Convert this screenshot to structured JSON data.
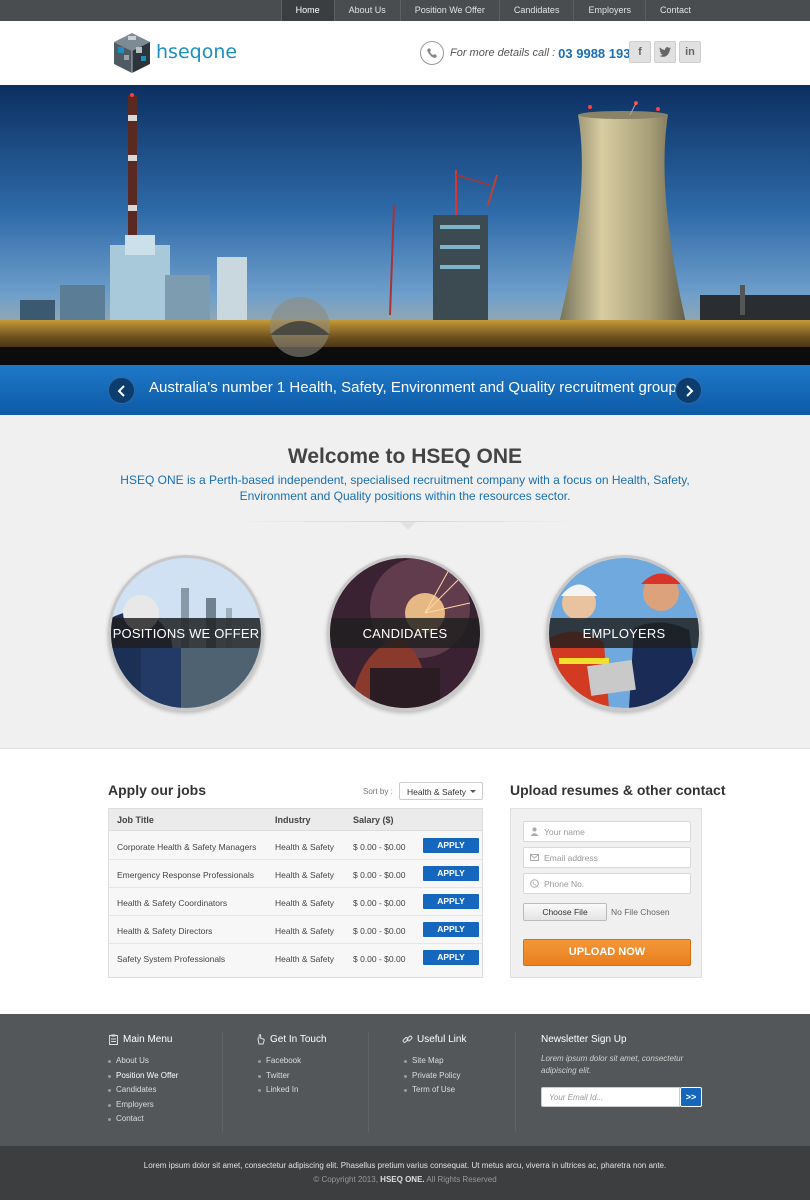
{
  "nav": {
    "items": [
      {
        "label": "Home",
        "active": true
      },
      {
        "label": "About Us"
      },
      {
        "label": "Position We Offer"
      },
      {
        "label": "Candidates"
      },
      {
        "label": "Employers"
      },
      {
        "label": "Contact"
      }
    ]
  },
  "header": {
    "logo_text": "hseqone",
    "phone_label": "For more details call :",
    "phone_number": "03 9988 1933",
    "social": [
      {
        "icon": "facebook-icon",
        "label": "f"
      },
      {
        "icon": "twitter-icon",
        "label": "t"
      },
      {
        "icon": "linkedin-icon",
        "label": "in"
      }
    ]
  },
  "slider": {
    "caption": "Australia's number 1 Health, Safety, Environment and Quality recruitment group"
  },
  "welcome": {
    "title": "Welcome to HSEQ ONE",
    "description": "HSEQ ONE is a Perth-based independent, specialised recruitment company with a focus on Health, Safety, Environment and Quality positions within the resources sector.",
    "circles": [
      {
        "label": "POSITIONS WE OFFER"
      },
      {
        "label": "CANDIDATES"
      },
      {
        "label": "EMPLOYERS"
      }
    ]
  },
  "jobs": {
    "title": "Apply our jobs",
    "sort_label": "Sort by :",
    "sort_value": "Health & Safety",
    "columns": [
      "Job Title",
      "Industry",
      "Salary ($)"
    ],
    "apply_label": "APPLY",
    "rows": [
      {
        "title": "Corporate Health & Safety Managers",
        "industry": "Health & Safety",
        "salary": "$ 0.00 - $0.00"
      },
      {
        "title": "Emergency Response Professionals",
        "industry": "Health & Safety",
        "salary": "$ 0.00 - $0.00"
      },
      {
        "title": "Health & Safety Coordinators",
        "industry": "Health & Safety",
        "salary": "$ 0.00 - $0.00"
      },
      {
        "title": "Health & Safety Directors",
        "industry": "Health & Safety",
        "salary": "$ 0.00 - $0.00"
      },
      {
        "title": "Safety System Professionals",
        "industry": "Health & Safety",
        "salary": "$ 0.00 - $0.00"
      }
    ]
  },
  "upload": {
    "title": "Upload resumes & other contact",
    "name_placeholder": "Your name",
    "email_placeholder": "Email address",
    "phone_placeholder": "Phone No.",
    "choose_label": "Choose File",
    "nofile_label": "No File Chosen",
    "submit_label": "UPLOAD NOW"
  },
  "footer": {
    "menu": {
      "title": "Main Menu",
      "items": [
        "About Us",
        "Position We Offer",
        "Candidates",
        "Employers",
        "Contact"
      ]
    },
    "touch": {
      "title": "Get In Touch",
      "items": [
        "Facebook",
        "Twitter",
        "Linked In"
      ]
    },
    "useful": {
      "title": "Useful Link",
      "items": [
        "Site Map",
        "Private Policy",
        "Term of Use"
      ]
    },
    "newsletter": {
      "title": "Newsletter Sign Up",
      "description": "Lorem ipsum dolor sit amet, consectetur adipiscing elit.",
      "placeholder": "Your Email Id...",
      "submit_label": ">>"
    },
    "bottom_text": "Lorem ipsum dolor sit amet, consectetur adipiscing elit. Phasellus pretium varius consequat. Ut metus arcu, viverra in ultrices ac, pharetra non ante.",
    "copyright_prefix": "© Copyright 2013,",
    "copyright_brand": "HSEQ ONE.",
    "copyright_suffix": "All Rights Reserved"
  },
  "colors": {
    "brand_blue": "#1567be",
    "accent_orange": "#ea7f1c",
    "nav_bg": "#4a4d50",
    "footer_bg": "#545759"
  }
}
